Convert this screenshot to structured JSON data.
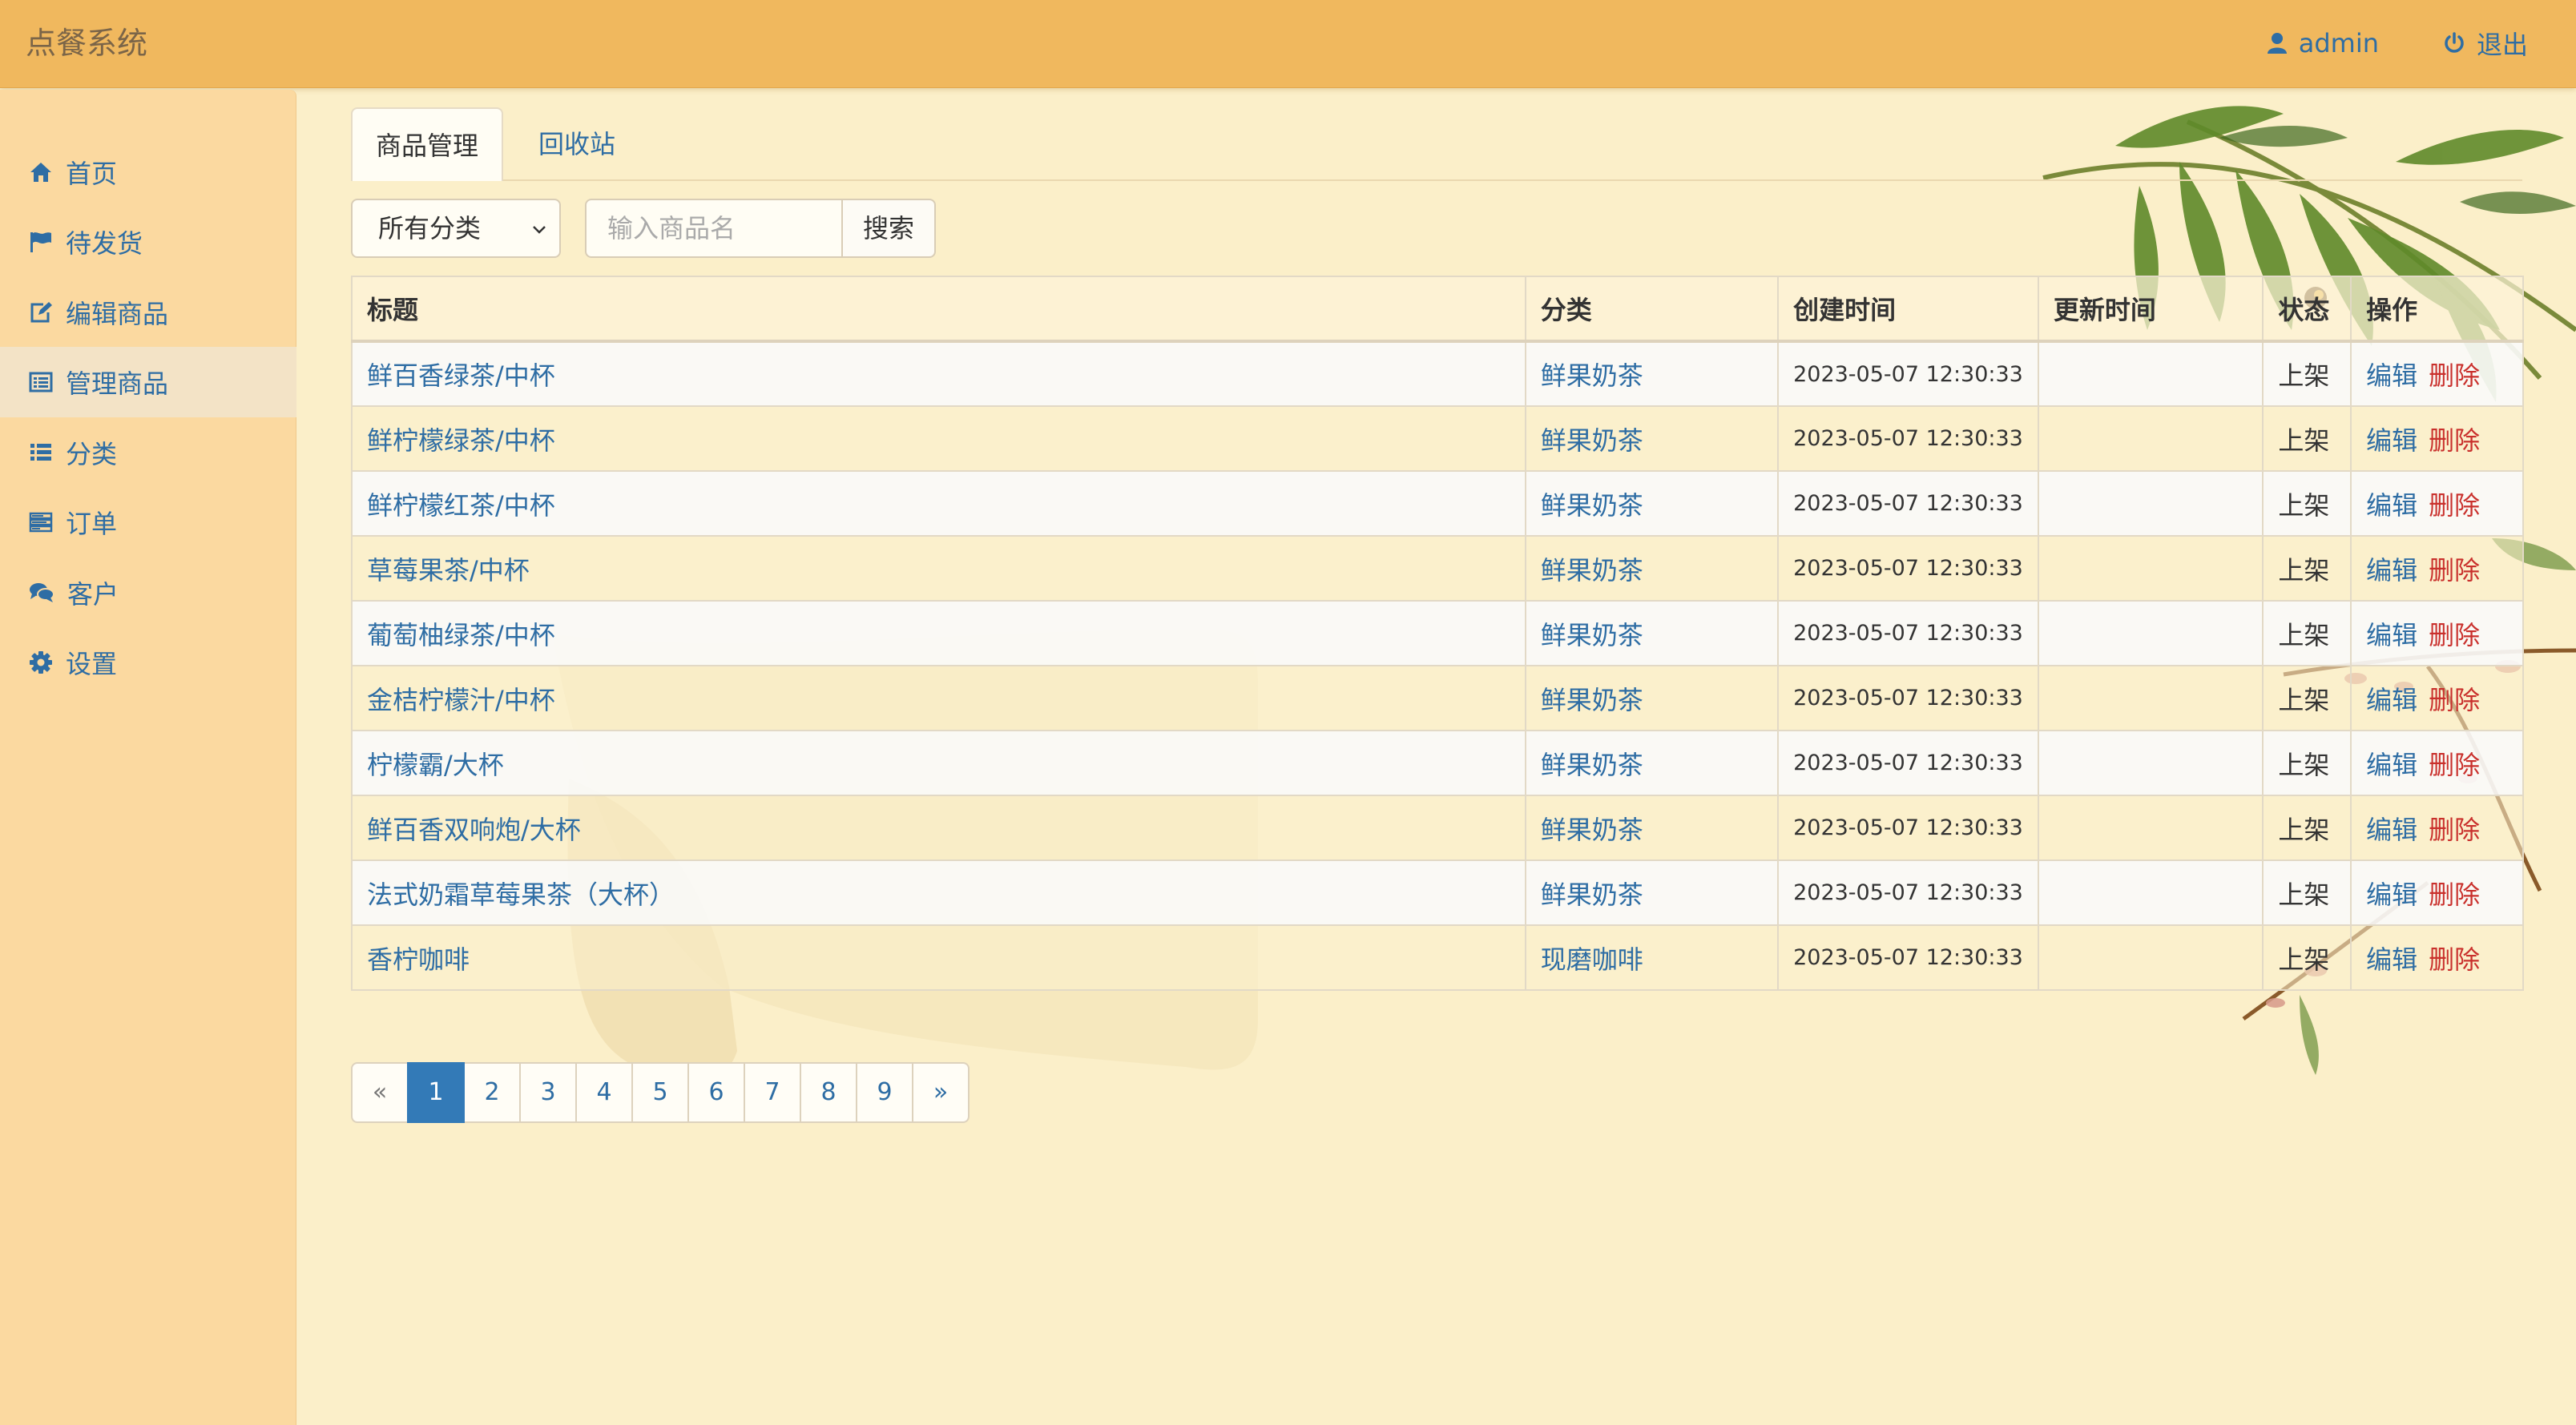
{
  "app": {
    "brand": "点餐系统",
    "user": "admin",
    "logout": "退出"
  },
  "sidebar": {
    "items": [
      {
        "label": "首页",
        "icon": "home-icon"
      },
      {
        "label": "待发货",
        "icon": "flag-icon"
      },
      {
        "label": "编辑商品",
        "icon": "edit-icon"
      },
      {
        "label": "管理商品",
        "icon": "list-alt-icon",
        "active": true
      },
      {
        "label": "分类",
        "icon": "list-icon"
      },
      {
        "label": "订单",
        "icon": "tasks-icon"
      },
      {
        "label": "客户",
        "icon": "comments-icon"
      },
      {
        "label": "设置",
        "icon": "gear-icon"
      }
    ]
  },
  "tabs": [
    {
      "label": "商品管理",
      "active": true
    },
    {
      "label": "回收站",
      "active": false
    }
  ],
  "filter": {
    "category_selected": "所有分类",
    "search_placeholder": "输入商品名",
    "search_button": "搜索"
  },
  "table": {
    "headers": [
      "标题",
      "分类",
      "创建时间",
      "更新时间",
      "状态",
      "操作"
    ],
    "rows": [
      {
        "title": "鲜百香绿茶/中杯",
        "category": "鲜果奶茶",
        "created": "2023-05-07 12:30:33",
        "updated": "",
        "status": "上架"
      },
      {
        "title": "鲜柠檬绿茶/中杯",
        "category": "鲜果奶茶",
        "created": "2023-05-07 12:30:33",
        "updated": "",
        "status": "上架"
      },
      {
        "title": "鲜柠檬红茶/中杯",
        "category": "鲜果奶茶",
        "created": "2023-05-07 12:30:33",
        "updated": "",
        "status": "上架"
      },
      {
        "title": "草莓果茶/中杯",
        "category": "鲜果奶茶",
        "created": "2023-05-07 12:30:33",
        "updated": "",
        "status": "上架"
      },
      {
        "title": "葡萄柚绿茶/中杯",
        "category": "鲜果奶茶",
        "created": "2023-05-07 12:30:33",
        "updated": "",
        "status": "上架"
      },
      {
        "title": "金桔柠檬汁/中杯",
        "category": "鲜果奶茶",
        "created": "2023-05-07 12:30:33",
        "updated": "",
        "status": "上架"
      },
      {
        "title": "柠檬霸/大杯",
        "category": "鲜果奶茶",
        "created": "2023-05-07 12:30:33",
        "updated": "",
        "status": "上架"
      },
      {
        "title": "鲜百香双响炮/大杯",
        "category": "鲜果奶茶",
        "created": "2023-05-07 12:30:33",
        "updated": "",
        "status": "上架"
      },
      {
        "title": "法式奶霜草莓果茶（大杯）",
        "category": "鲜果奶茶",
        "created": "2023-05-07 12:30:33",
        "updated": "",
        "status": "上架"
      },
      {
        "title": "香柠咖啡",
        "category": "现磨咖啡",
        "created": "2023-05-07 12:30:33",
        "updated": "",
        "status": "上架"
      }
    ],
    "actions": {
      "edit": "编辑",
      "delete": "删除"
    }
  },
  "pagination": {
    "prev": "«",
    "next": "»",
    "pages": [
      "1",
      "2",
      "3",
      "4",
      "5",
      "6",
      "7",
      "8",
      "9"
    ],
    "current": "1"
  },
  "colors": {
    "navbar": "#f0b85e",
    "sidebar": "#fbd9a0",
    "background": "#fbefc9",
    "link": "#2e6da4",
    "danger": "#c9302c",
    "active_page": "#337ab7"
  }
}
